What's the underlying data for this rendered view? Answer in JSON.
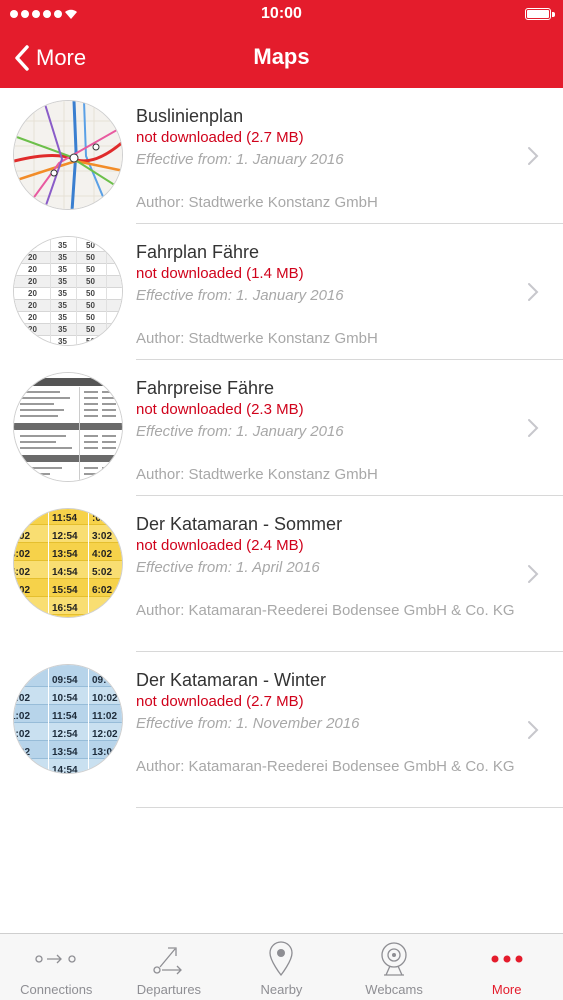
{
  "status_bar": {
    "time": "10:00"
  },
  "nav": {
    "back_label": "More",
    "title": "Maps"
  },
  "items": [
    {
      "title": "Buslinienplan",
      "status": "not downloaded (2.7 MB)",
      "effective": "Effective from: 1. January 2016",
      "author": "Author: Stadtwerke Konstanz GmbH"
    },
    {
      "title": "Fahrplan Fähre",
      "status": "not downloaded (1.4 MB)",
      "effective": "Effective from: 1. January 2016",
      "author": "Author: Stadtwerke Konstanz GmbH"
    },
    {
      "title": "Fahrpreise Fähre",
      "status": "not downloaded (2.3 MB)",
      "effective": "Effective from: 1. January 2016",
      "author": "Author: Stadtwerke Konstanz GmbH"
    },
    {
      "title": "Der Katamaran - Sommer",
      "status": "not downloaded (2.4 MB)",
      "effective": "Effective from: 1. April 2016",
      "author": "Author: Katamaran-Reederei Bodensee GmbH & Co. KG"
    },
    {
      "title": "Der Katamaran - Winter",
      "status": "not downloaded (2.7 MB)",
      "effective": "Effective from: 1. November 2016",
      "author": "Author: Katamaran-Reederei Bodensee GmbH & Co. KG"
    }
  ],
  "thumb_text": {
    "ferry_rows": [
      [
        "20",
        "35",
        "50"
      ],
      [
        "20",
        "35",
        "50"
      ],
      [
        "20",
        "35",
        "50"
      ],
      [
        "20",
        "35",
        "50"
      ],
      [
        "20",
        "35",
        "50"
      ],
      [
        "20",
        "35",
        "50"
      ],
      [
        "20",
        "35",
        "50"
      ],
      [
        "20",
        "35",
        "50"
      ],
      [
        "20",
        "35",
        "50"
      ]
    ],
    "summer_rows": [
      [
        "",
        "11:54",
        ":02"
      ],
      [
        "2:02",
        "12:54",
        "3:02"
      ],
      [
        "3:02",
        "13:54",
        "4:02"
      ],
      [
        "4:02",
        "14:54",
        "5:02"
      ],
      [
        "5:02",
        "15:54",
        "6:02"
      ],
      [
        "",
        "16:54",
        ""
      ]
    ],
    "winter_rows": [
      [
        "",
        "09:54",
        "09:"
      ],
      [
        "0:02",
        "10:54",
        "10:02"
      ],
      [
        "1:02",
        "11:54",
        "11:02"
      ],
      [
        "2:02",
        "12:54",
        "12:02"
      ],
      [
        "3:02",
        "13:54",
        "13:02"
      ],
      [
        "",
        "14:54",
        ""
      ]
    ]
  },
  "tabs": [
    {
      "label": "Connections",
      "icon": "connections-icon"
    },
    {
      "label": "Departures",
      "icon": "departures-icon"
    },
    {
      "label": "Nearby",
      "icon": "location-pin-icon"
    },
    {
      "label": "Webcams",
      "icon": "webcam-icon"
    },
    {
      "label": "More",
      "icon": "more-icon"
    }
  ],
  "colors": {
    "accent": "#e41c2c",
    "status_red": "#d0021b",
    "muted": "#a8a8a8"
  }
}
